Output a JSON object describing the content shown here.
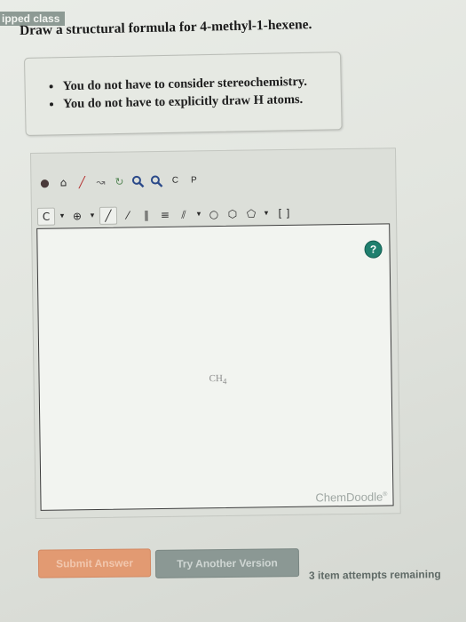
{
  "header": {
    "class_tag": "ipped class"
  },
  "question": {
    "prompt": "Draw a structural formula for 4-methyl-1-hexene.",
    "notes": [
      "You do not have to consider stereochemistry.",
      "You do not have to explicitly draw H atoms."
    ]
  },
  "toolbar": {
    "row1": [
      {
        "name": "clear-icon",
        "glyph": "●",
        "color": "#4a3a3a"
      },
      {
        "name": "eraser-icon",
        "glyph": "⌂",
        "color": "#2a2a2a"
      },
      {
        "name": "pencil-icon",
        "glyph": "╱",
        "color": "#b22a2a"
      },
      {
        "name": "lasso-icon",
        "glyph": "↝",
        "color": "#6a6a6a"
      },
      {
        "name": "rotate-icon",
        "glyph": "↻",
        "color": "#5a8a5a"
      },
      {
        "name": "zoom-in-icon",
        "glyph": "🔍",
        "color": "#2b4a8a"
      },
      {
        "name": "zoom-out-icon",
        "glyph": "🔍",
        "color": "#2b4a8a"
      },
      {
        "name": "clean-icon",
        "glyph": "C",
        "color": "#2a2a2a"
      },
      {
        "name": "paste-icon",
        "glyph": "P",
        "color": "#2a2a2a"
      }
    ],
    "row2": [
      {
        "name": "carbon-atom-icon",
        "glyph": "C",
        "color": "#2a2a2a"
      },
      {
        "name": "charge-icon",
        "glyph": "⊕",
        "color": "#2a2a2a"
      },
      {
        "name": "single-bond-icon",
        "glyph": "╱",
        "color": "#2a2a2a"
      },
      {
        "name": "wedge-bond-icon",
        "glyph": "⁄",
        "color": "#2a2a2a"
      },
      {
        "name": "double-bond-icon",
        "glyph": "∥",
        "color": "#2a2a2a"
      },
      {
        "name": "triple-bond-icon",
        "glyph": "≡",
        "color": "#2a2a2a"
      },
      {
        "name": "hash-bond-icon",
        "glyph": "⫽",
        "color": "#2a2a2a"
      },
      {
        "name": "cyclopropane-icon",
        "glyph": "○",
        "color": "#2a2a2a"
      },
      {
        "name": "benzene-icon",
        "glyph": "⬡",
        "color": "#2a2a2a"
      },
      {
        "name": "cyclohexane-icon",
        "glyph": "⬠",
        "color": "#2a2a2a"
      },
      {
        "name": "bracket-icon",
        "glyph": "[ ]",
        "color": "#2a2a2a"
      }
    ]
  },
  "canvas": {
    "molecule_label": "CH",
    "molecule_subscript": "4",
    "help_label": "?",
    "watermark": "ChemDoodle",
    "watermark_mark": "®"
  },
  "actions": {
    "submit_label": "Submit Answer",
    "try_label": "Try Another Version",
    "attempts_text": "3 item attempts remaining"
  },
  "colors": {
    "accent_submit": "#e29a72",
    "accent_try": "#8b9894",
    "help_green": "#1f7f6e"
  }
}
